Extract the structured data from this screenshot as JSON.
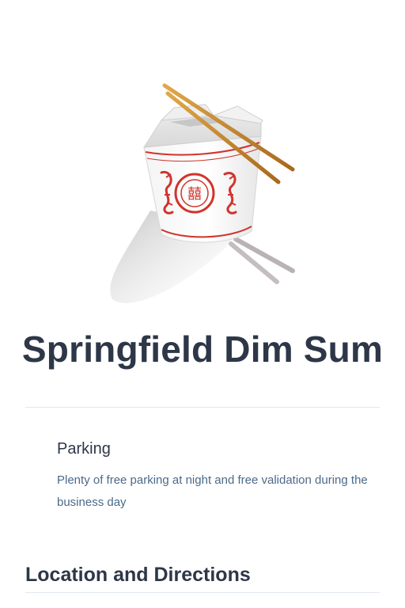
{
  "restaurant": {
    "name": "Springfield Dim Sum"
  },
  "hero": {
    "icon": "takeout-box-icon",
    "chopsticks_color": "#c98a2b",
    "accent_red": "#d0342c"
  },
  "amenities": [
    {
      "title": "Parking",
      "description": "Plenty of free parking at night and free validation during the business day"
    }
  ],
  "sections": {
    "location_heading": "Location and Directions"
  }
}
